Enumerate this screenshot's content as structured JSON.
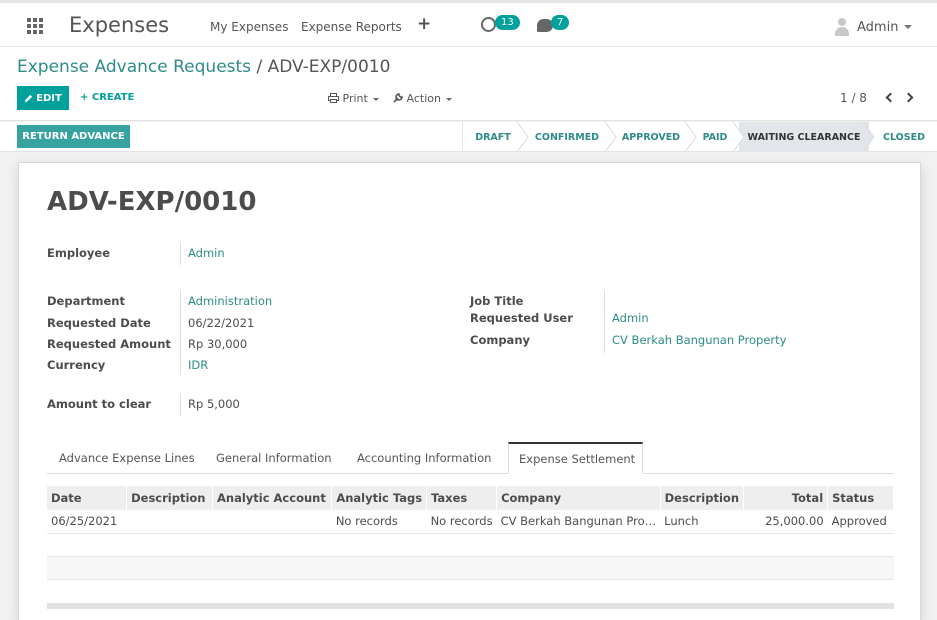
{
  "topbar": {
    "app_title": "Expenses",
    "nav": [
      "My Expenses",
      "Expense Reports"
    ],
    "plus": "+",
    "activity_count": "13",
    "message_count": "7",
    "user_name": "Admin"
  },
  "control": {
    "breadcrumb_parent": "Expense Advance Requests",
    "breadcrumb_sep": "/",
    "breadcrumb_current": "ADV-EXP/0010",
    "edit_label": "EDIT",
    "create_label": "+ CREATE",
    "print_label": "Print",
    "action_label": "Action",
    "pager": "1 / 8"
  },
  "status": {
    "return_label": "RETURN ADVANCE",
    "stages": [
      "DRAFT",
      "CONFIRMED",
      "APPROVED",
      "PAID",
      "WAITING CLEARANCE",
      "CLOSED"
    ],
    "active_stage": "WAITING CLEARANCE"
  },
  "form": {
    "title": "ADV-EXP/0010",
    "employee_label": "Employee",
    "employee": "Admin",
    "department_label": "Department",
    "department": "Administration",
    "requested_date_label": "Requested Date",
    "requested_date": "06/22/2021",
    "requested_amount_label": "Requested Amount",
    "requested_amount": "Rp 30,000",
    "currency_label": "Currency",
    "currency": "IDR",
    "amount_to_clear_label": "Amount to clear",
    "amount_to_clear": "Rp 5,000",
    "job_title_label": "Job Title",
    "job_title": "",
    "requested_user_label": "Requested User",
    "requested_user": "Admin",
    "company_label": "Company",
    "company": "CV Berkah Bangunan Property"
  },
  "tabs": [
    "Advance Expense Lines",
    "General Information",
    "Accounting Information",
    "Expense Settlement"
  ],
  "active_tab": "Expense Settlement",
  "table": {
    "headers": [
      "Date",
      "Description",
      "Analytic Account",
      "Analytic Tags",
      "Taxes",
      "Company",
      "Description",
      "Total",
      "Status"
    ],
    "rows": [
      [
        "06/25/2021",
        "",
        "",
        "No records",
        "No records",
        "CV Berkah Bangunan Pro…",
        "Lunch",
        "25,000.00",
        "Approved"
      ]
    ]
  }
}
